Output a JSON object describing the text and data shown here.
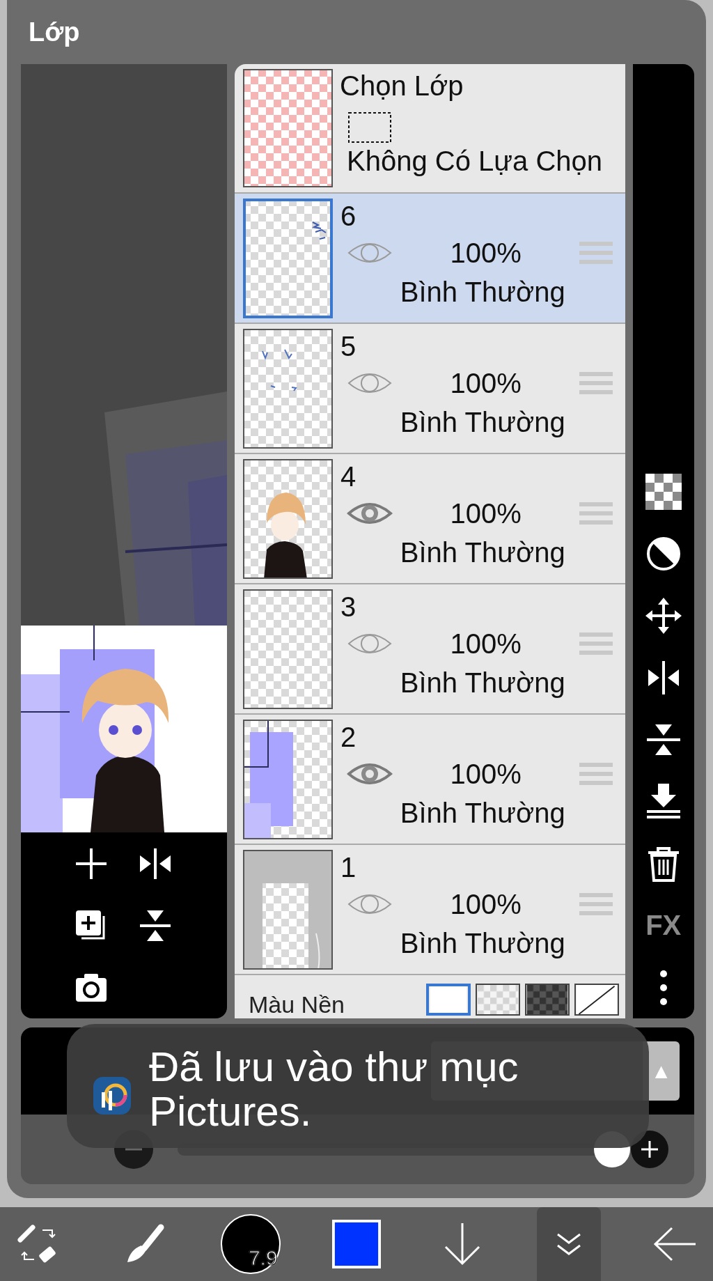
{
  "title": "Lớp",
  "selection_layer": {
    "title": "Chọn Lớp",
    "status": "Không Có Lựa Chọn"
  },
  "layers": [
    {
      "name": "6",
      "kind": "marks",
      "opacity": "100%",
      "blend_mode": "Bình Thường",
      "selected": true,
      "eye_emphasized": false
    },
    {
      "name": "5",
      "kind": "dots",
      "opacity": "100%",
      "blend_mode": "Bình Thường",
      "selected": false,
      "eye_emphasized": false
    },
    {
      "name": "4",
      "kind": "figure",
      "opacity": "100%",
      "blend_mode": "Bình Thường",
      "selected": false,
      "eye_emphasized": true
    },
    {
      "name": "3",
      "kind": "empty",
      "opacity": "100%",
      "blend_mode": "Bình Thường",
      "selected": false,
      "eye_emphasized": false
    },
    {
      "name": "2",
      "kind": "panel",
      "opacity": "100%",
      "blend_mode": "Bình Thường",
      "selected": false,
      "eye_emphasized": true
    },
    {
      "name": "1",
      "kind": "frame",
      "opacity": "100%",
      "blend_mode": "Bình Thường",
      "selected": false,
      "eye_emphasized": false
    }
  ],
  "background_color": {
    "label": "Màu Nền",
    "options": [
      {
        "kind": "white",
        "selected": true
      },
      {
        "kind": "light-checker",
        "selected": false
      },
      {
        "kind": "dark-checker",
        "selected": false
      },
      {
        "kind": "none",
        "selected": false
      }
    ]
  },
  "right_toolbar": [
    {
      "kind": "checker"
    },
    {
      "kind": "contrast"
    },
    {
      "kind": "move"
    },
    {
      "kind": "flip-h"
    },
    {
      "kind": "flip-v"
    },
    {
      "kind": "merge-down"
    },
    {
      "kind": "trash"
    },
    {
      "kind": "fx",
      "label": "FX"
    },
    {
      "kind": "more"
    }
  ],
  "blend_arrow": "▲",
  "opacity_slider": {
    "level": 1.0
  },
  "toast": {
    "message": "Đã lưu vào thư mục Pictures."
  },
  "bottom_tools": [
    {
      "kind": "transform",
      "selected": false
    },
    {
      "kind": "brush",
      "selected": false
    },
    {
      "kind": "brush-size",
      "label": "7.9",
      "selected": false
    },
    {
      "kind": "color",
      "color": "#0033ff",
      "selected": false
    },
    {
      "kind": "down",
      "selected": false
    },
    {
      "kind": "layers",
      "selected": true
    },
    {
      "kind": "back",
      "selected": false
    }
  ]
}
